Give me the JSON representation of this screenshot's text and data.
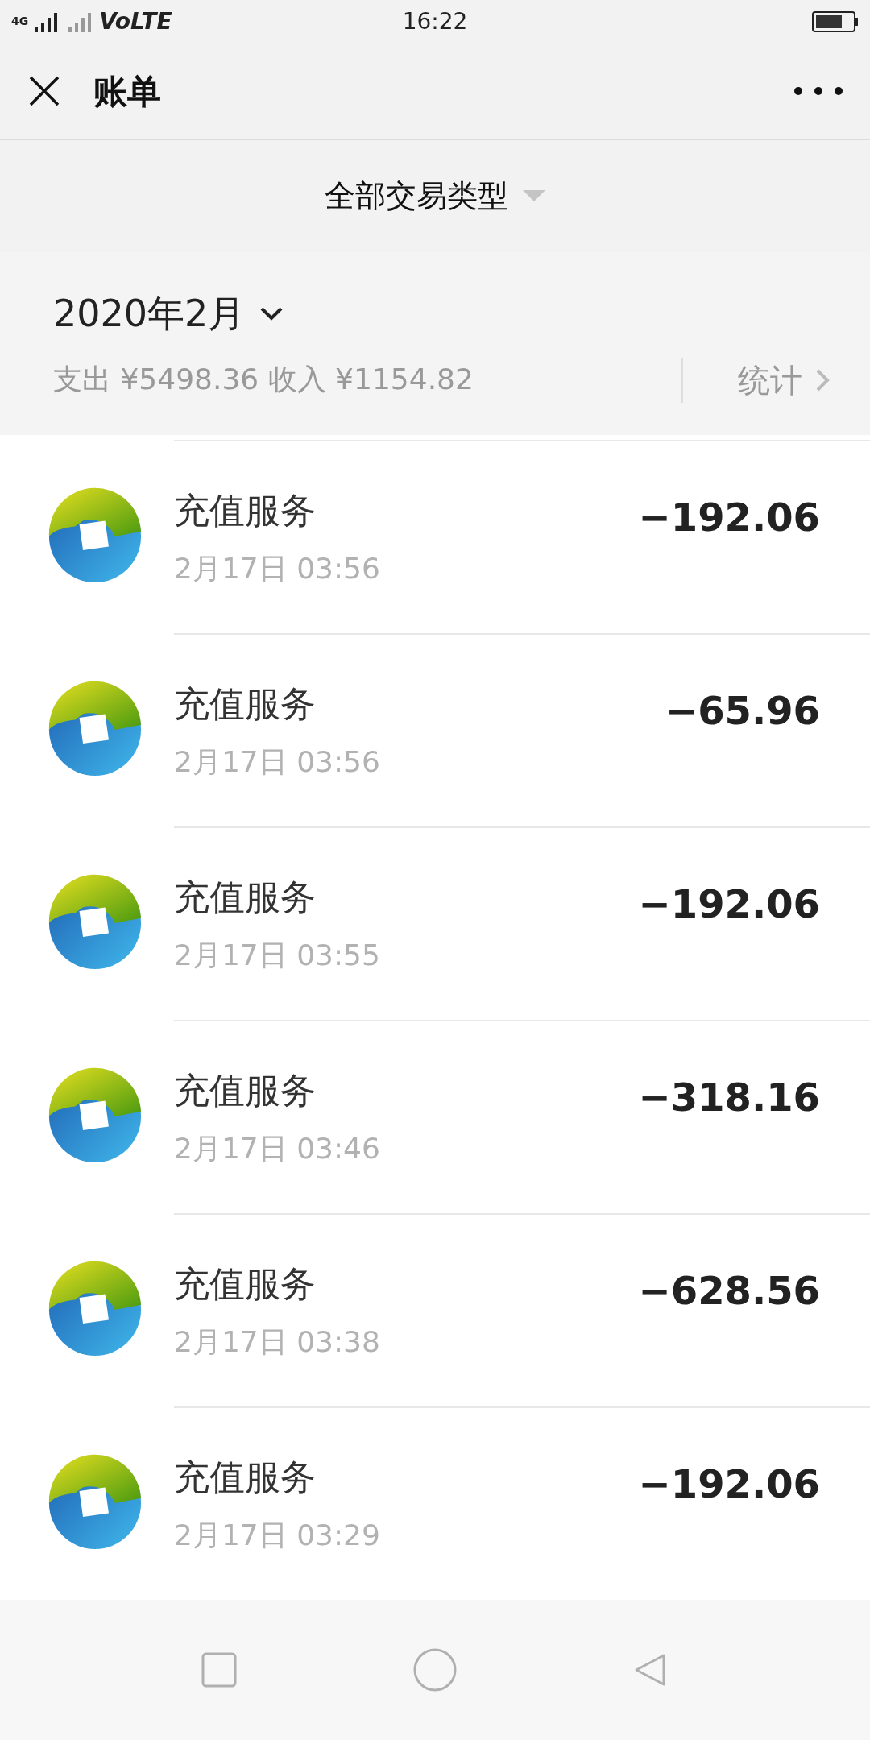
{
  "status_bar": {
    "network": "4G",
    "carrier": "VoLTE",
    "time": "16:22"
  },
  "header": {
    "title": "账单"
  },
  "filter": {
    "label": "全部交易类型"
  },
  "month": {
    "label": "2020年2月",
    "summary": "支出 ¥5498.36 收入 ¥1154.82",
    "stats_link": "统计"
  },
  "transactions": [
    {
      "title": "充值服务",
      "time": "2月17日 03:56",
      "amount": "−192.06"
    },
    {
      "title": "充值服务",
      "time": "2月17日 03:56",
      "amount": "−65.96"
    },
    {
      "title": "充值服务",
      "time": "2月17日 03:55",
      "amount": "−192.06"
    },
    {
      "title": "充值服务",
      "time": "2月17日 03:46",
      "amount": "−318.16"
    },
    {
      "title": "充值服务",
      "time": "2月17日 03:38",
      "amount": "−628.56"
    },
    {
      "title": "充值服务",
      "time": "2月17日 03:29",
      "amount": "−192.06"
    }
  ]
}
